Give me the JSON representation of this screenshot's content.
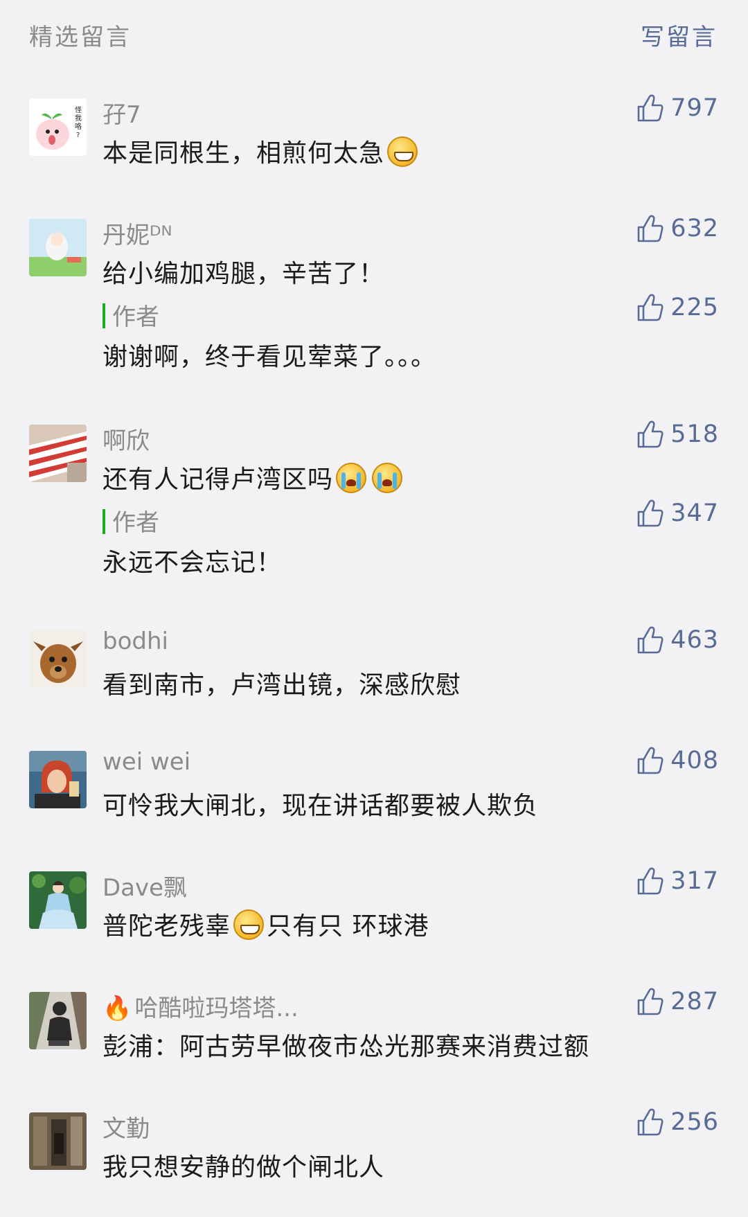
{
  "header": {
    "title": "精选留言",
    "write_label": "写留言"
  },
  "colors": {
    "background": "#f2f2f4",
    "link": "#576b95",
    "muted": "#8a8a8a",
    "author_bar": "#1aad19"
  },
  "icons": {
    "like": "thumbs-up-icon",
    "grin": "grinning-emoji-icon",
    "cry": "crying-emoji-icon",
    "fire": "fire-emoji-icon"
  },
  "comments": [
    {
      "nickname": "孖7",
      "content_before": "本是同根生，相煎何太急",
      "content_after": "",
      "likes": "797",
      "avatar_text": "怪我咯?"
    },
    {
      "nickname": "丹妮ᴰᴺ",
      "content": "给小编加鸡腿，辛苦了！",
      "likes": "632",
      "reply": {
        "label": "作者",
        "text": "谢谢啊，终于看见荤菜了。。。",
        "likes": "225"
      }
    },
    {
      "nickname": "啊欣",
      "content": "还有人记得卢湾区吗",
      "likes": "518",
      "reply": {
        "label": "作者",
        "text": "永远不会忘记！",
        "likes": "347"
      }
    },
    {
      "nickname": "bodhi",
      "content": "看到南市，卢湾出镜，深感欣慰",
      "likes": "463"
    },
    {
      "nickname": "wei wei",
      "content": "可怜我大闸北，现在讲话都要被人欺负",
      "likes": "408"
    },
    {
      "nickname": "Dave飘",
      "content_before": "普陀老残辜",
      "content_after": "只有只 环球港",
      "likes": "317"
    },
    {
      "nickname": "哈酷啦玛塔塔...",
      "content": "彭浦：阿古劳早做夜市怂光那赛来消费过额",
      "likes": "287"
    },
    {
      "nickname": "文勤",
      "content": "我只想安静的做个闸北人",
      "likes": "256"
    }
  ]
}
